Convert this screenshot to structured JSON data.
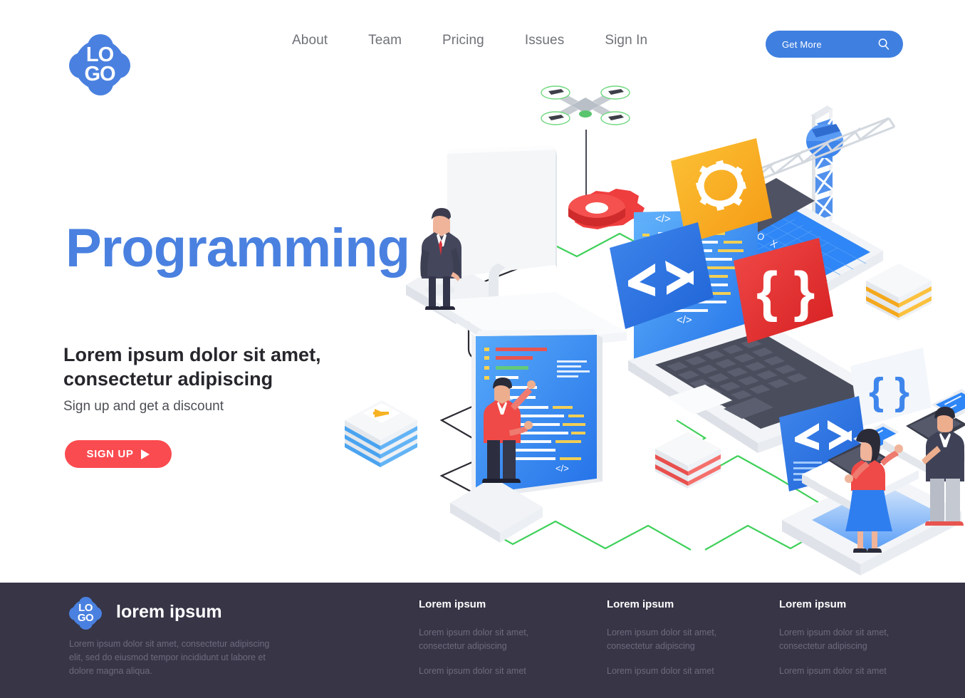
{
  "header": {
    "logo": {
      "line1": "LO",
      "line2": "GO",
      "name": "logo"
    },
    "nav": [
      {
        "label": "About"
      },
      {
        "label": "Team"
      },
      {
        "label": "Pricing"
      },
      {
        "label": "Issues"
      },
      {
        "label": "Sign In"
      }
    ],
    "cta": {
      "label": "Get More",
      "icon": "search-icon"
    }
  },
  "hero": {
    "title": "Programming",
    "subtitle": "Lorem ipsum dolor sit amet, consectetur adipiscing",
    "note": "Sign up and get a discount",
    "button": {
      "label": "SIGN UP",
      "icon": "play-triangle-icon"
    }
  },
  "illustration": {
    "alt": "isometric programming scene",
    "elements": [
      "drone",
      "red-gear",
      "desktop-monitor",
      "businessman",
      "laptop-with-code-editor",
      "orange-gear-card",
      "blue-code-card",
      "red-braces-card",
      "construction-crane",
      "code-screen-with-developer",
      "layer-stack-blue",
      "layer-stack-red",
      "layer-stack-yellow",
      "standing-desks-with-two-developers",
      "white-braces-card"
    ],
    "code_window_controls": "— O X",
    "card_glyphs": {
      "blue_card": "</>",
      "red_card": "{ }",
      "white_card": "{ }"
    },
    "colors": {
      "accent_blue": "#3f7fe0",
      "screen_blue": "#2f86f6",
      "accent_red": "#ef3e3e",
      "accent_orange": "#f9b023",
      "path_green": "#3fd05a",
      "path_dark": "#2b2b33"
    }
  },
  "footer": {
    "logo": {
      "line1": "LO",
      "line2": "GO"
    },
    "brand": "lorem ipsum",
    "description": "Lorem ipsum dolor sit amet, consectetur adipiscing elit, sed do eiusmod tempor incididunt ut labore et dolore magna aliqua.",
    "columns": [
      {
        "heading": "Lorem ipsum",
        "links": [
          "Lorem ipsum dolor sit amet, consectetur adipiscing",
          "Lorem ipsum dolor sit amet"
        ]
      },
      {
        "heading": "Lorem ipsum",
        "links": [
          "Lorem ipsum dolor sit amet, consectetur adipiscing",
          "Lorem ipsum dolor sit amet"
        ]
      },
      {
        "heading": "Lorem ipsum",
        "links": [
          "Lorem ipsum dolor sit amet, consectetur adipiscing",
          "Lorem ipsum dolor sit amet"
        ]
      }
    ],
    "background_color": "#373546"
  }
}
